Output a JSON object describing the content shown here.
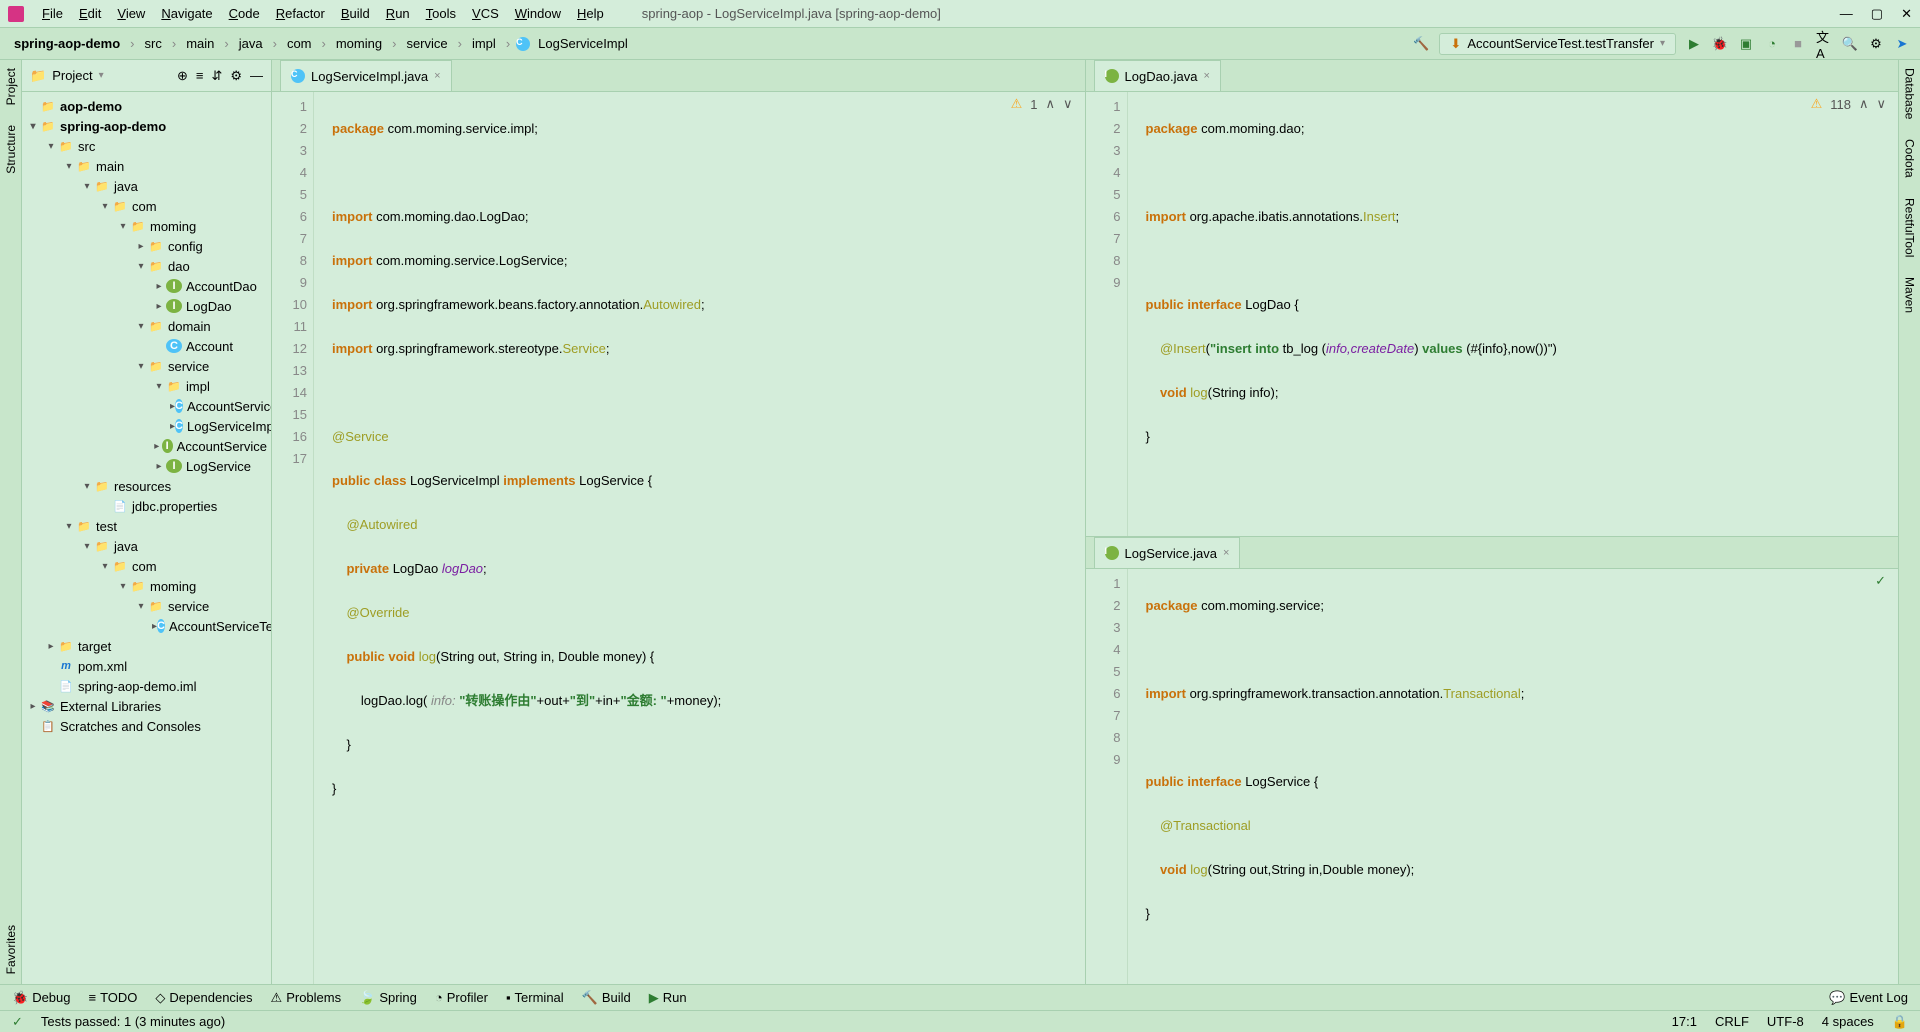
{
  "window": {
    "title": "spring-aop - LogServiceImpl.java [spring-aop-demo]"
  },
  "menu": [
    "File",
    "Edit",
    "View",
    "Navigate",
    "Code",
    "Refactor",
    "Build",
    "Run",
    "Tools",
    "VCS",
    "Window",
    "Help"
  ],
  "breadcrumb": [
    "spring-aop-demo",
    "src",
    "main",
    "java",
    "com",
    "moming",
    "service",
    "impl",
    "LogServiceImpl"
  ],
  "run_config": "AccountServiceTest.testTransfer",
  "left_tools": [
    "Project",
    "Structure",
    "Favorites"
  ],
  "right_tools": [
    "Database",
    "Codota",
    "RestfulTool",
    "Maven"
  ],
  "project_panel": {
    "title": "Project",
    "tree": {
      "root1": "aop-demo",
      "root2": "spring-aop-demo",
      "src": "src",
      "main": "main",
      "java": "java",
      "com": "com",
      "moming": "moming",
      "config": "config",
      "dao": "dao",
      "accountdao": "AccountDao",
      "logdao": "LogDao",
      "domain": "domain",
      "account": "Account",
      "service": "service",
      "impl": "impl",
      "accountserviceimpl": "AccountServiceImpl",
      "logserviceimpl": "LogServiceImpl",
      "accountservice": "AccountService",
      "logservice": "LogService",
      "resources": "resources",
      "jdbc": "jdbc.properties",
      "test": "test",
      "test_java": "java",
      "test_com": "com",
      "test_moming": "moming",
      "test_service": "service",
      "accountservicetest": "AccountServiceTest",
      "target": "target",
      "pom": "pom.xml",
      "iml": "spring-aop-demo.iml",
      "ext_lib": "External Libraries",
      "scratches": "Scratches and Consoles"
    }
  },
  "tabs": {
    "left": "LogServiceImpl.java",
    "right_top": "LogDao.java",
    "right_bottom": "LogService.java"
  },
  "warnings": {
    "left": "1",
    "right_top": "118"
  },
  "code_left": {
    "lines": [
      "1",
      "2",
      "3",
      "4",
      "5",
      "6",
      "7",
      "8",
      "9",
      "10",
      "11",
      "12",
      "13",
      "14",
      "15",
      "16",
      "17"
    ],
    "l1a": "package",
    "l1b": " com.moming.service.impl;",
    "l3a": "import",
    "l3b": " com.moming.dao.LogDao;",
    "l4a": "import",
    "l4b": " com.moming.service.LogService;",
    "l5a": "import",
    "l5b": " org.springframework.beans.factory.annotation.",
    "l5c": "Autowired",
    "l5d": ";",
    "l6a": "import",
    "l6b": " org.springframework.stereotype.",
    "l6c": "Service",
    "l6d": ";",
    "l8": "@Service",
    "l9a": "public",
    "l9b": " class",
    "l9c": " LogServiceImpl ",
    "l9d": "implements",
    "l9e": " LogService {",
    "l10": "    @Autowired",
    "l11a": "    private",
    "l11b": " LogDao ",
    "l11c": "logDao",
    "l11d": ";",
    "l12": "    @Override",
    "l13a": "    public",
    "l13b": " void",
    "l13c": " log",
    "l13d": "(String out, String in, Double money) {",
    "l14a": "        logDao.log( ",
    "l14h": "info:",
    "l14b": " \"转账操作由\"",
    "l14c": "+out+",
    "l14d": "\"到\"",
    "l14e": "+in+",
    "l14f": "\"金额: \"",
    "l14g": "+money);",
    "l15": "    }",
    "l16": "}"
  },
  "code_rt": {
    "lines": [
      "1",
      "2",
      "3",
      "4",
      "5",
      "6",
      "7",
      "8",
      "9"
    ],
    "l1a": "package",
    "l1b": " com.moming.dao;",
    "l3a": "import",
    "l3b": " org.apache.ibatis.annotations.",
    "l3c": "Insert",
    "l3d": ";",
    "l5a": "public",
    "l5b": " interface",
    "l5c": " LogDao {",
    "l6a": "    @Insert",
    "l6b": "(",
    "l6c": "\"insert into ",
    "l6d": "tb_log (",
    "l6e": "info,createDate",
    "l6f": ") ",
    "l6g": "values ",
    "l6h": "(#{info},now())\"",
    "l6i": ")",
    "l7a": "    void",
    "l7b": " log",
    "l7c": "(String info);",
    "l8": "}"
  },
  "code_rb": {
    "lines": [
      "1",
      "2",
      "3",
      "4",
      "5",
      "6",
      "7",
      "8",
      "9"
    ],
    "l1a": "package",
    "l1b": " com.moming.service;",
    "l3a": "import",
    "l3b": " org.springframework.transaction.annotation.",
    "l3c": "Transactional",
    "l3d": ";",
    "l5a": "public",
    "l5b": " interface",
    "l5c": " LogService {",
    "l6": "    @Transactional",
    "l7a": "    void",
    "l7b": " log",
    "l7c": "(String out,String in,Double money);",
    "l8": "}"
  },
  "bottom_tools": [
    "Debug",
    "TODO",
    "Dependencies",
    "Problems",
    "Spring",
    "Profiler",
    "Terminal",
    "Build",
    "Run"
  ],
  "event_log": "Event Log",
  "status": {
    "tests": "Tests passed: 1 (3 minutes ago)",
    "pos": "17:1",
    "sep": "CRLF",
    "enc": "UTF-8",
    "indent": "4 spaces"
  }
}
